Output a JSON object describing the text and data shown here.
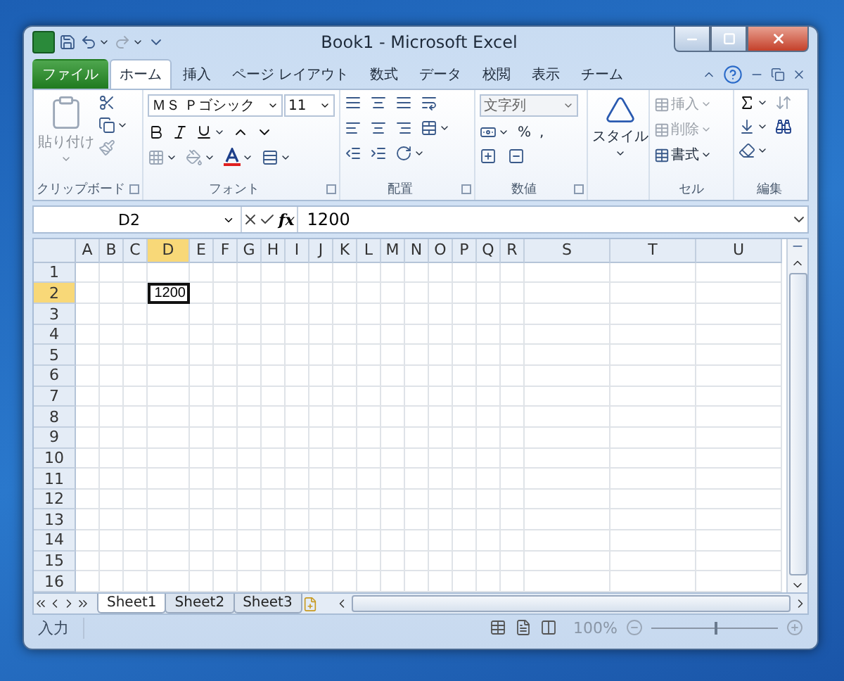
{
  "window": {
    "title": "Book1 - Microsoft Excel"
  },
  "ribbon_tabs": [
    {
      "label": "ファイル",
      "kind": "file",
      "selected": false
    },
    {
      "label": "ホーム",
      "kind": "tab",
      "selected": true
    },
    {
      "label": "挿入",
      "kind": "tab",
      "selected": false
    },
    {
      "label": "ページ レイアウト",
      "kind": "tab",
      "selected": false
    },
    {
      "label": "数式",
      "kind": "tab",
      "selected": false
    },
    {
      "label": "データ",
      "kind": "tab",
      "selected": false
    },
    {
      "label": "校閲",
      "kind": "tab",
      "selected": false
    },
    {
      "label": "表示",
      "kind": "tab",
      "selected": false
    },
    {
      "label": "チーム",
      "kind": "tab",
      "selected": false
    }
  ],
  "ribbon": {
    "clipboard": {
      "paste": "貼り付け",
      "label": "クリップボード"
    },
    "font": {
      "name": "ＭＳ Ｐゴシック",
      "size": "11",
      "label": "フォント"
    },
    "alignment": {
      "label": "配置"
    },
    "number": {
      "format": "文字列",
      "percent": "%",
      "comma": ",",
      "label": "数値"
    },
    "styles": {
      "button": "スタイル"
    },
    "cells": {
      "items": [
        {
          "label": "挿入",
          "disabled": true
        },
        {
          "label": "削除",
          "disabled": true
        },
        {
          "label": "書式",
          "disabled": false
        }
      ],
      "label": "セル"
    },
    "editing": {
      "label": "編集"
    }
  },
  "formula_bar": {
    "name_box": "D2",
    "function_button": "fx",
    "value": "1200"
  },
  "sheet": {
    "columns": [
      {
        "label": "A",
        "selected": false
      },
      {
        "label": "B",
        "selected": false
      },
      {
        "label": "C",
        "selected": false
      },
      {
        "label": "D",
        "selected": true,
        "kind": "medium"
      },
      {
        "label": "E",
        "selected": false
      },
      {
        "label": "F",
        "selected": false
      },
      {
        "label": "G",
        "selected": false
      },
      {
        "label": "H",
        "selected": false
      },
      {
        "label": "I",
        "selected": false
      },
      {
        "label": "J",
        "selected": false
      },
      {
        "label": "K",
        "selected": false
      },
      {
        "label": "L",
        "selected": false
      },
      {
        "label": "M",
        "selected": false
      },
      {
        "label": "N",
        "selected": false
      },
      {
        "label": "O",
        "selected": false
      },
      {
        "label": "P",
        "selected": false
      },
      {
        "label": "Q",
        "selected": false
      },
      {
        "label": "R",
        "selected": false
      },
      {
        "label": "S",
        "selected": false,
        "kind": "wide"
      },
      {
        "label": "T",
        "selected": false,
        "kind": "wide"
      },
      {
        "label": "U",
        "selected": false,
        "kind": "wide"
      }
    ],
    "rows": [
      {
        "label": "1",
        "selected": false
      },
      {
        "label": "2",
        "selected": true
      },
      {
        "label": "3",
        "selected": false
      },
      {
        "label": "4",
        "selected": false
      },
      {
        "label": "5",
        "selected": false
      },
      {
        "label": "6",
        "selected": false
      },
      {
        "label": "7",
        "selected": false
      },
      {
        "label": "8",
        "selected": false
      },
      {
        "label": "9",
        "selected": false
      },
      {
        "label": "10",
        "selected": false
      },
      {
        "label": "11",
        "selected": false
      },
      {
        "label": "12",
        "selected": false
      },
      {
        "label": "13",
        "selected": false
      },
      {
        "label": "14",
        "selected": false
      },
      {
        "label": "15",
        "selected": false
      },
      {
        "label": "16",
        "selected": false
      }
    ],
    "active_cell_value": "1200"
  },
  "sheet_tabs": [
    {
      "label": "Sheet1",
      "selected": true
    },
    {
      "label": "Sheet2",
      "selected": false
    },
    {
      "label": "Sheet3",
      "selected": false
    }
  ],
  "status_bar": {
    "mode": "入力",
    "zoom": "100%",
    "level": 0.5
  }
}
